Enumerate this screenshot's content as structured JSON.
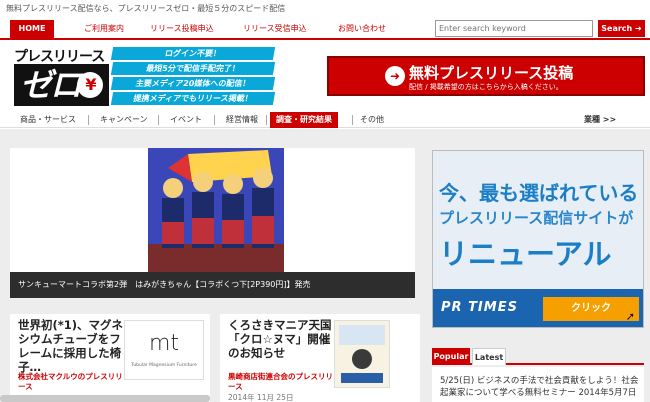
{
  "tagline": "無料プレスリリース配信なら、プレスリリースゼロ・最短５分のスピード配信",
  "nav": {
    "home": "HOME",
    "items": [
      "ご利用案内",
      "リリース投稿申込",
      "リリース受信申込",
      "お問い合わせ"
    ]
  },
  "search": {
    "placeholder": "Enter search keyword",
    "button": "Search"
  },
  "logo": {
    "top": "プレスリリース",
    "main": "ゼロ",
    "mark": "¥"
  },
  "features": [
    "ログイン不要！",
    "最短5分で配信手配完了！",
    "主要メディア20媒体への配信！",
    "提携メディアでもリリース掲載！"
  ],
  "post_banner": {
    "title": "無料プレスリリース投稿",
    "subtitle": "配信 / 掲載希望の方はこちらから入稿ください。"
  },
  "categories": [
    "商品・サービス",
    "キャンペーン",
    "イベント",
    "経営情報",
    "調査・研究結果",
    "その他"
  ],
  "categories_more": "業種 >>",
  "hero": {
    "caption": "サンキューマートコラボ第2弾　はみがきちゃん【コラボくつ下[2P390円]】発売"
  },
  "cards": [
    {
      "title": "世界初(*1)、マグネシウムチューブをフレームに採用した椅子…",
      "company": "株式会社マクルウのプレスリリース",
      "date": "",
      "thumb_text": "mt",
      "thumb_sub": "Tubular Magnesium Furniture"
    },
    {
      "title": "くろさきマニア天国「クロ☆ヌマ」開催のお知らせ",
      "company": "黒崎商店街連合会のプレスリリース",
      "date": "2014年 11月 25日",
      "thumb_text": "",
      "thumb_sub": ""
    }
  ],
  "ad": {
    "line1": "今、最も選ばれている",
    "line2": "プレスリリース配信サイトが",
    "line3": "リニューアル",
    "brand": "PR TIMES",
    "button": "クリック"
  },
  "tabs": [
    "Popular",
    "Latest"
  ],
  "news": "5/25(日) ビジネスの手法で社会貢献をしよう！社会起業家について学べる無料セミナー 2014年5月7日",
  "colors": {
    "brand_red": "#cc0000",
    "accent_blue": "#0aa8d8",
    "ad_blue": "#1b64b0",
    "ad_orange": "#f6a000"
  }
}
